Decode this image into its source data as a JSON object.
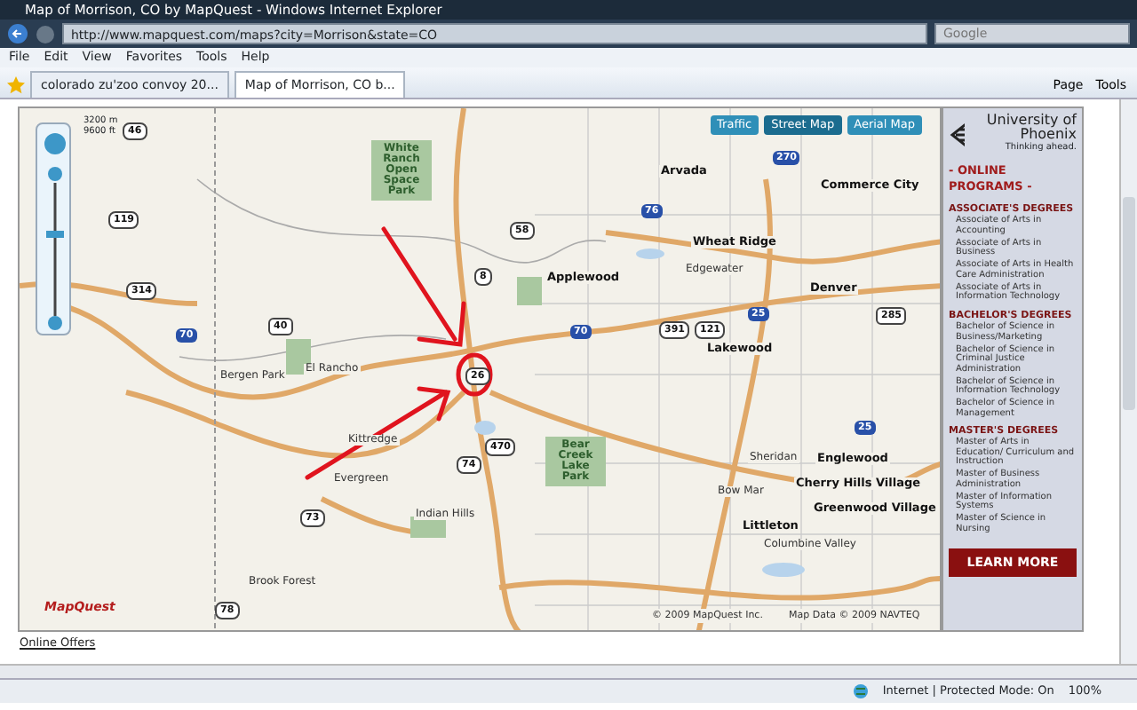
{
  "window": {
    "title": "Map of Morrison, CO by MapQuest - Windows Internet Explorer"
  },
  "address_bar": {
    "url": "http://www.mapquest.com/maps?city=Morrison&state=CO"
  },
  "search": {
    "placeholder": "Google"
  },
  "menu": [
    "File",
    "Edit",
    "View",
    "Favorites",
    "Tools",
    "Help"
  ],
  "tabs": [
    {
      "label": "colorado zu'zoo convoy 20...",
      "selected": false
    },
    {
      "label": "Map of Morrison, CO b...",
      "selected": true
    }
  ],
  "command_bar": [
    "Page",
    "Tools"
  ],
  "map": {
    "scale": [
      "3200 m",
      "9600 ft"
    ],
    "view_buttons": [
      {
        "label": "Traffic",
        "selected": false
      },
      {
        "label": "Street Map",
        "selected": true
      },
      {
        "label": "Aerial Map",
        "selected": false
      }
    ],
    "places": [
      {
        "label": "White Ranch Open Space Park",
        "kind": "park"
      },
      {
        "label": "Arvada",
        "kind": "city"
      },
      {
        "label": "Commerce City",
        "kind": "city"
      },
      {
        "label": "Wheat Ridge",
        "kind": "city"
      },
      {
        "label": "Edgewater",
        "kind": "town"
      },
      {
        "label": "Applewood",
        "kind": "city"
      },
      {
        "label": "Denver",
        "kind": "city"
      },
      {
        "label": "Lakewood",
        "kind": "city"
      },
      {
        "label": "El Rancho",
        "kind": "town"
      },
      {
        "label": "Bergen Park",
        "kind": "town"
      },
      {
        "label": "Kittredge",
        "kind": "town"
      },
      {
        "label": "Evergreen",
        "kind": "town"
      },
      {
        "label": "Indian Hills",
        "kind": "town"
      },
      {
        "label": "Bear Creek Lake Park",
        "kind": "park"
      },
      {
        "label": "Sheridan",
        "kind": "town"
      },
      {
        "label": "Englewood",
        "kind": "city"
      },
      {
        "label": "Cherry Hills Village",
        "kind": "city"
      },
      {
        "label": "Bow Mar",
        "kind": "town"
      },
      {
        "label": "Littleton",
        "kind": "city"
      },
      {
        "label": "Greenwood Village",
        "kind": "city"
      },
      {
        "label": "Columbine Valley",
        "kind": "town"
      },
      {
        "label": "Brook Forest",
        "kind": "town"
      }
    ],
    "shields": [
      {
        "label": "46",
        "kind": "state"
      },
      {
        "label": "119",
        "kind": "state"
      },
      {
        "label": "314",
        "kind": "state"
      },
      {
        "label": "58",
        "kind": "state"
      },
      {
        "label": "70",
        "kind": "interstate"
      },
      {
        "label": "76",
        "kind": "interstate"
      },
      {
        "label": "270",
        "kind": "interstate"
      },
      {
        "label": "25",
        "kind": "interstate"
      },
      {
        "label": "391",
        "kind": "state"
      },
      {
        "label": "121",
        "kind": "state"
      },
      {
        "label": "26",
        "kind": "state"
      },
      {
        "label": "470",
        "kind": "state"
      },
      {
        "label": "74",
        "kind": "state"
      },
      {
        "label": "73",
        "kind": "state"
      },
      {
        "label": "8",
        "kind": "state"
      },
      {
        "label": "285",
        "kind": "us"
      },
      {
        "label": "40",
        "kind": "us"
      },
      {
        "label": "78",
        "kind": "state"
      },
      {
        "label": "70",
        "kind": "interstate"
      },
      {
        "label": "25",
        "kind": "interstate"
      }
    ],
    "logo": "MapQuest",
    "copyright": "© 2009 MapQuest Inc.",
    "map_data": "Map Data © 2009 NAVTEQ"
  },
  "ad": {
    "brand": "University of Phoenix",
    "tagline": "Thinking ahead.",
    "heading": "- ONLINE PROGRAMS -",
    "sections": [
      {
        "title": "ASSOCIATE'S DEGREES",
        "items": [
          "Associate of Arts in Accounting",
          "Associate of Arts in Business",
          "Associate of Arts in Health Care Administration",
          "Associate of Arts in Information Technology"
        ]
      },
      {
        "title": "BACHELOR'S DEGREES",
        "items": [
          "Bachelor of Science in Business/Marketing",
          "Bachelor of Science in Criminal Justice Administration",
          "Bachelor of Science in Information Technology",
          "Bachelor of Science in Management"
        ]
      },
      {
        "title": "MASTER'S DEGREES",
        "items": [
          "Master of Arts in Education/ Curriculum and Instruction",
          "Master of Business Administration",
          "Master of Information Systems",
          "Master of Science in Nursing"
        ]
      }
    ],
    "button": "LEARN MORE"
  },
  "online_offers": "Online Offers",
  "status_bar": {
    "zone": "Internet | Protected Mode: On",
    "zoom": "100%"
  }
}
